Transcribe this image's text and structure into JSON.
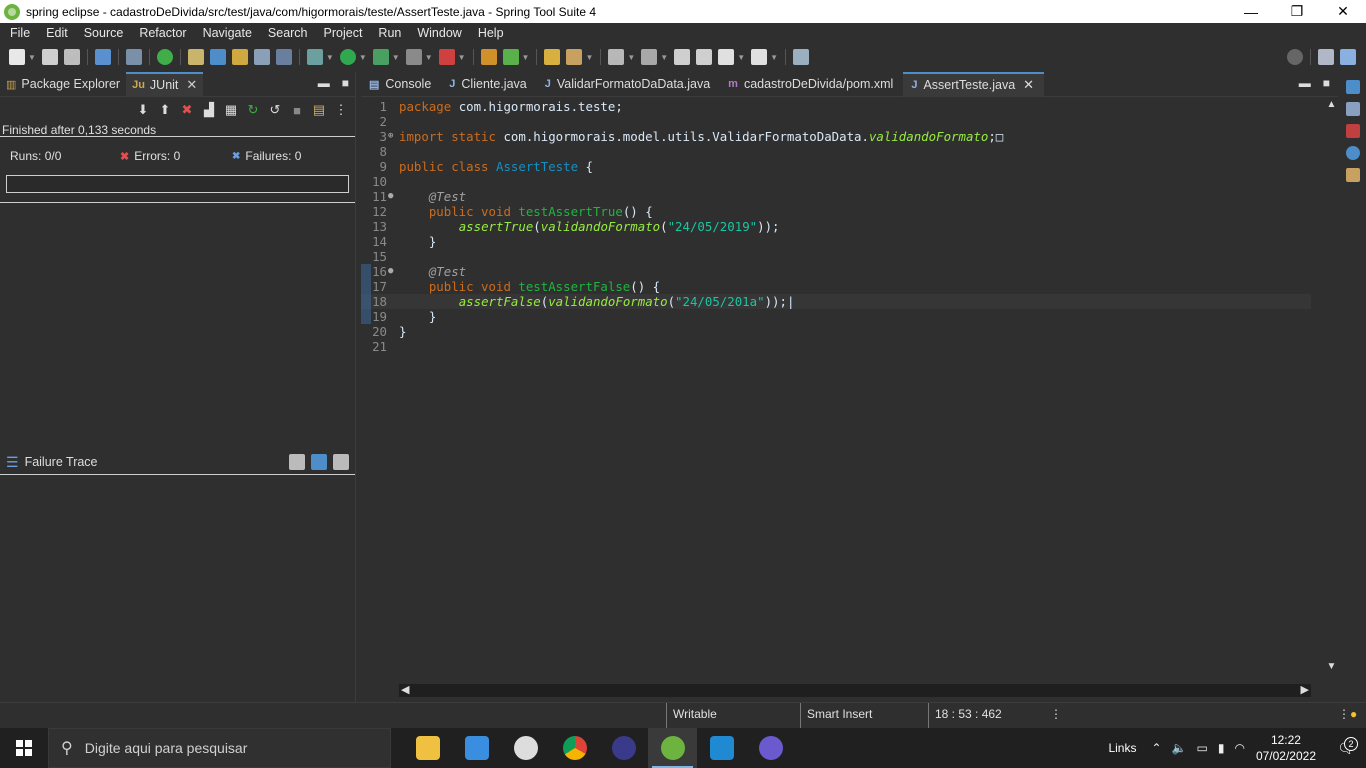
{
  "window": {
    "title": "spring eclipse - cadastroDeDivida/src/test/java/com/higormorais/teste/AssertTeste.java - Spring Tool Suite 4",
    "minimize_glyph": "—",
    "restore_glyph": "❐",
    "close_glyph": "✕"
  },
  "menubar": {
    "items": [
      "File",
      "Edit",
      "Source",
      "Refactor",
      "Navigate",
      "Search",
      "Project",
      "Run",
      "Window",
      "Help"
    ]
  },
  "left_panel": {
    "tabs": [
      {
        "label": "Package Explorer",
        "icon": "package-explorer-icon"
      },
      {
        "label": "JUnit",
        "icon": "junit-icon",
        "icon_text": "Ju"
      }
    ],
    "finished_text": "Finished after 0,133 seconds",
    "runs_label": "Runs:",
    "runs_value": "0/0",
    "errors_label": "Errors:",
    "errors_value": "0",
    "failures_label": "Failures:",
    "failures_value": "0",
    "failure_trace_label": "Failure Trace"
  },
  "editor": {
    "tabs": [
      {
        "label": "Console",
        "active": false
      },
      {
        "label": "Cliente.java",
        "active": false
      },
      {
        "label": "ValidarFormatoDaData.java",
        "active": false
      },
      {
        "label": "cadastroDeDivida/pom.xml",
        "active": false
      },
      {
        "label": "AssertTeste.java",
        "active": true
      }
    ],
    "current_line": 18,
    "lines": [
      {
        "n": "1",
        "segments": [
          [
            "kw",
            "package "
          ],
          [
            "plain",
            "com.higormorais.teste;"
          ]
        ]
      },
      {
        "n": "2",
        "segments": []
      },
      {
        "n": "3",
        "fold": "⊕",
        "segments": [
          [
            "kw",
            "import static "
          ],
          [
            "plain",
            "com.higormorais.model.utils.ValidarFormatoDaData."
          ],
          [
            "ital",
            "validandoFormato"
          ],
          [
            "plain",
            ";"
          ],
          [
            "plain",
            "□"
          ]
        ]
      },
      {
        "n": "8",
        "segments": []
      },
      {
        "n": "9",
        "segments": [
          [
            "kw",
            "public class "
          ],
          [
            "cls",
            "AssertTeste"
          ],
          [
            "plain",
            " {"
          ]
        ]
      },
      {
        "n": "10",
        "segments": []
      },
      {
        "n": "11",
        "fold": "●",
        "segments": [
          [
            "plain",
            "    "
          ],
          [
            "anno",
            "@Test"
          ]
        ]
      },
      {
        "n": "12",
        "segments": [
          [
            "plain",
            "    "
          ],
          [
            "kw",
            "public void "
          ],
          [
            "meth",
            "testAssertTrue"
          ],
          [
            "plain",
            "() {"
          ]
        ]
      },
      {
        "n": "13",
        "segments": [
          [
            "plain",
            "        "
          ],
          [
            "ital",
            "assertTrue"
          ],
          [
            "plain",
            "("
          ],
          [
            "ital",
            "validandoFormato"
          ],
          [
            "plain",
            "("
          ],
          [
            "str",
            "\"24/05/2019\""
          ],
          [
            "plain",
            "));"
          ]
        ]
      },
      {
        "n": "14",
        "segments": [
          [
            "plain",
            "    }"
          ]
        ]
      },
      {
        "n": "15",
        "segments": []
      },
      {
        "n": "16",
        "fold": "●",
        "segments": [
          [
            "plain",
            "    "
          ],
          [
            "anno",
            "@Test"
          ]
        ]
      },
      {
        "n": "17",
        "segments": [
          [
            "plain",
            "    "
          ],
          [
            "kw",
            "public void "
          ],
          [
            "meth",
            "testAssertFalse"
          ],
          [
            "plain",
            "() {"
          ]
        ]
      },
      {
        "n": "18",
        "segments": [
          [
            "plain",
            "        "
          ],
          [
            "ital",
            "assertFalse"
          ],
          [
            "plain",
            "("
          ],
          [
            "ital",
            "validandoFormato"
          ],
          [
            "plain",
            "("
          ],
          [
            "str",
            "\"24/05/201a\""
          ],
          [
            "plain",
            "));|"
          ]
        ]
      },
      {
        "n": "19",
        "segments": [
          [
            "plain",
            "    }"
          ]
        ]
      },
      {
        "n": "20",
        "segments": [
          [
            "plain",
            "}"
          ]
        ]
      },
      {
        "n": "21",
        "segments": []
      }
    ]
  },
  "statusbar": {
    "writable": "Writable",
    "insert_mode": "Smart Insert",
    "position": "18 : 53 : 462"
  },
  "taskbar": {
    "search_placeholder": "Digite aqui para pesquisar",
    "links_label": "Links",
    "time": "12:22",
    "date": "07/02/2022",
    "notification_count": "2",
    "apps": [
      "file-explorer-icon",
      "mail-icon",
      "settings-icon",
      "chrome-icon",
      "eclipse-icon",
      "spring-tool-suite-icon",
      "vscode-icon",
      "app-icon"
    ]
  },
  "colors": {
    "accent": "#4d8dc9",
    "keyword": "#cc6c1d",
    "class_name": "#1290c3",
    "method_decl": "#1eb540",
    "static_italic": "#96ec3f",
    "string": "#17c6a3",
    "error_red": "#e05050"
  }
}
